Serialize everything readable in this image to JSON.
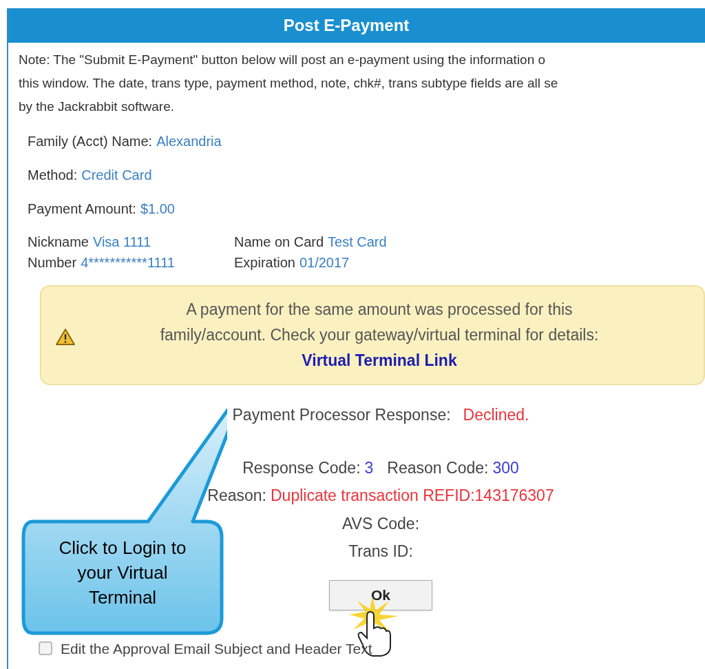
{
  "window": {
    "title": "Post E-Payment"
  },
  "note_lines": [
    "Note: The \"Submit E-Payment\" button below will post an e-payment using the information o",
    "this window. The date, trans type, payment method, note, chk#, trans subtype fields are all se",
    "by the Jackrabbit software."
  ],
  "fields": [
    {
      "label": "Family (Acct) Name:",
      "value": "Alexandria"
    },
    {
      "label": "Method:",
      "value": "Credit Card"
    },
    {
      "label": "Payment Amount:",
      "value": "$1.00"
    }
  ],
  "card": [
    {
      "label": "Nickname",
      "value": "Visa 1111"
    },
    {
      "label": "Name on Card",
      "value": "Test Card"
    },
    {
      "label": "Number",
      "value": "4***********1111"
    },
    {
      "label": "Expiration",
      "value": "01/2017"
    }
  ],
  "warning": {
    "lines": [
      "A payment for the same amount was processed for this",
      "family/account. Check your gateway/virtual terminal for details:"
    ],
    "link": "Virtual Terminal Link"
  },
  "response": {
    "label": "Payment Processor Response:",
    "value": "Declined."
  },
  "codes": [
    {
      "label": "Response Code:",
      "value": "3"
    },
    {
      "label": "Reason Code:",
      "value": "300"
    }
  ],
  "reason": {
    "label": "Reason:",
    "value": "Duplicate transaction REFID:143176307"
  },
  "details": [
    "AVS Code:",
    "Trans ID:"
  ],
  "ok_button": "Ok",
  "callout": {
    "lines": [
      "Click to Login to",
      "your Virtual",
      "Terminal"
    ]
  },
  "checkbox": {
    "label": "Edit the Approval Email Subject and Header Text",
    "checked": false
  }
}
